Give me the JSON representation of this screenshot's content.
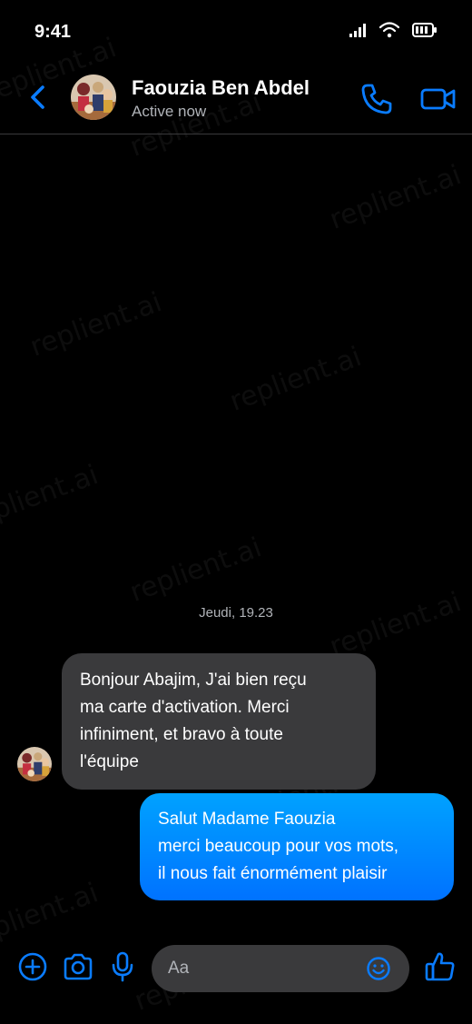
{
  "status_bar": {
    "time": "9:41",
    "icons": [
      "signal-icon",
      "wifi-icon",
      "battery-icon"
    ]
  },
  "header": {
    "back_icon": "chevron-left-icon",
    "contact_name": "Faouzia Ben Abdel",
    "contact_status": "Active now",
    "call_icon": "phone-icon",
    "video_icon": "video-camera-icon"
  },
  "conversation": {
    "date_separator": "Jeudi, 19.23",
    "incoming": {
      "lines": [
        "Bonjour Abajim, J'ai bien reçu",
        "ma carte d'activation. Merci",
        "infiniment, et bravo à toute",
        "l'équipe"
      ]
    },
    "outgoing": {
      "lines": [
        "Salut Madame Faouzia",
        "merci beaucoup pour vos mots,",
        "il nous fait énormément plaisir"
      ]
    }
  },
  "composer": {
    "placeholder": "Aa",
    "icons": [
      "plus-circle-icon",
      "camera-icon",
      "microphone-icon",
      "emoji-icon",
      "thumbs-up-icon"
    ]
  },
  "watermark": "replient.ai",
  "colors": {
    "accent": "#0a7cff",
    "incoming_bubble": "#3a3a3c",
    "outgoing_gradient_top": "#00a2ff",
    "outgoing_gradient_bottom": "#0072ff",
    "background": "#000000"
  }
}
